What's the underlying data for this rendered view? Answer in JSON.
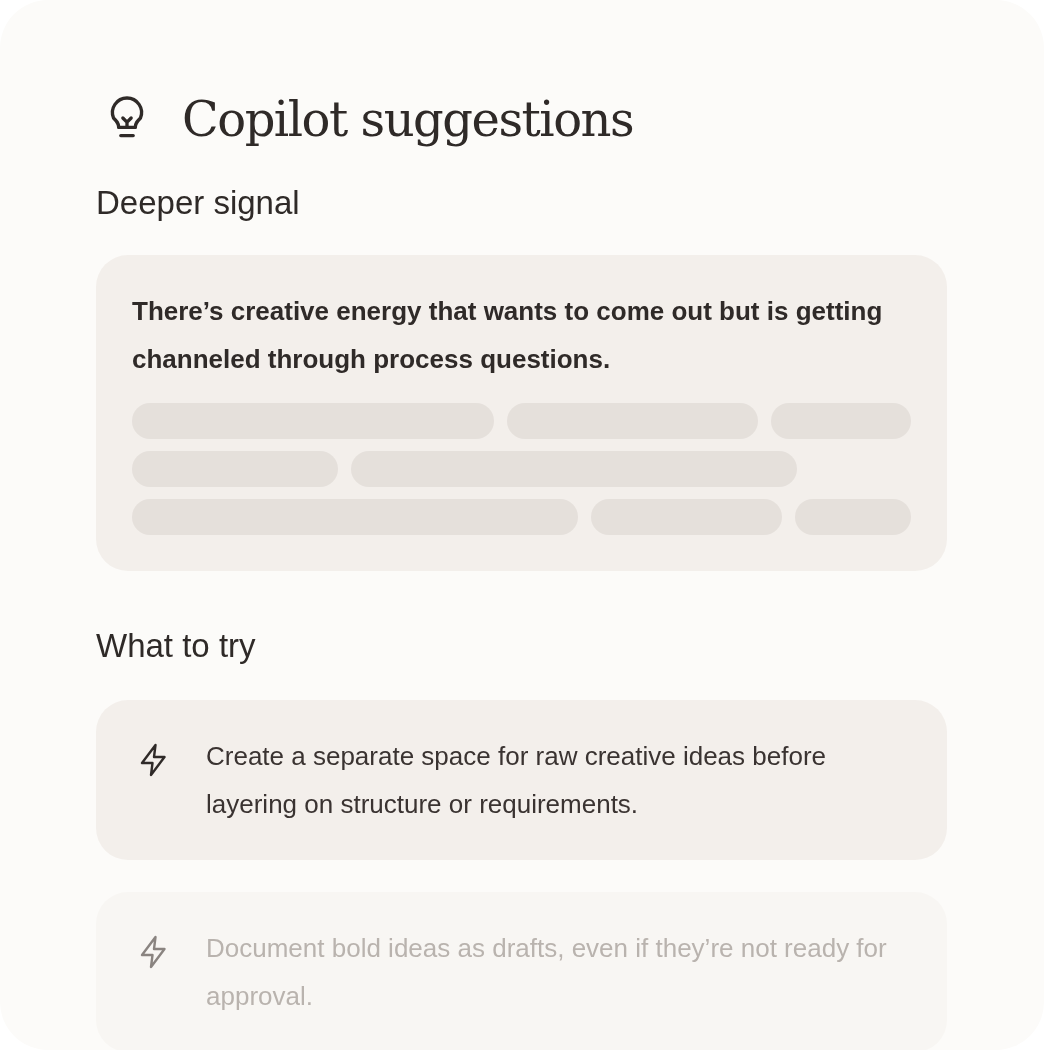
{
  "title": "Copilot suggestions",
  "deeper_signal": {
    "heading": "Deeper signal",
    "text": "There’s creative energy that wants to come out but is getting channeled through process questions."
  },
  "what_to_try": {
    "heading": "What to try",
    "suggestions": [
      {
        "text": "Create a separate space for raw creative ideas before layering on structure or requirements.",
        "dimmed": false
      },
      {
        "text": "Document bold ideas as drafts, even if they’re not ready for approval.",
        "dimmed": true
      }
    ]
  }
}
